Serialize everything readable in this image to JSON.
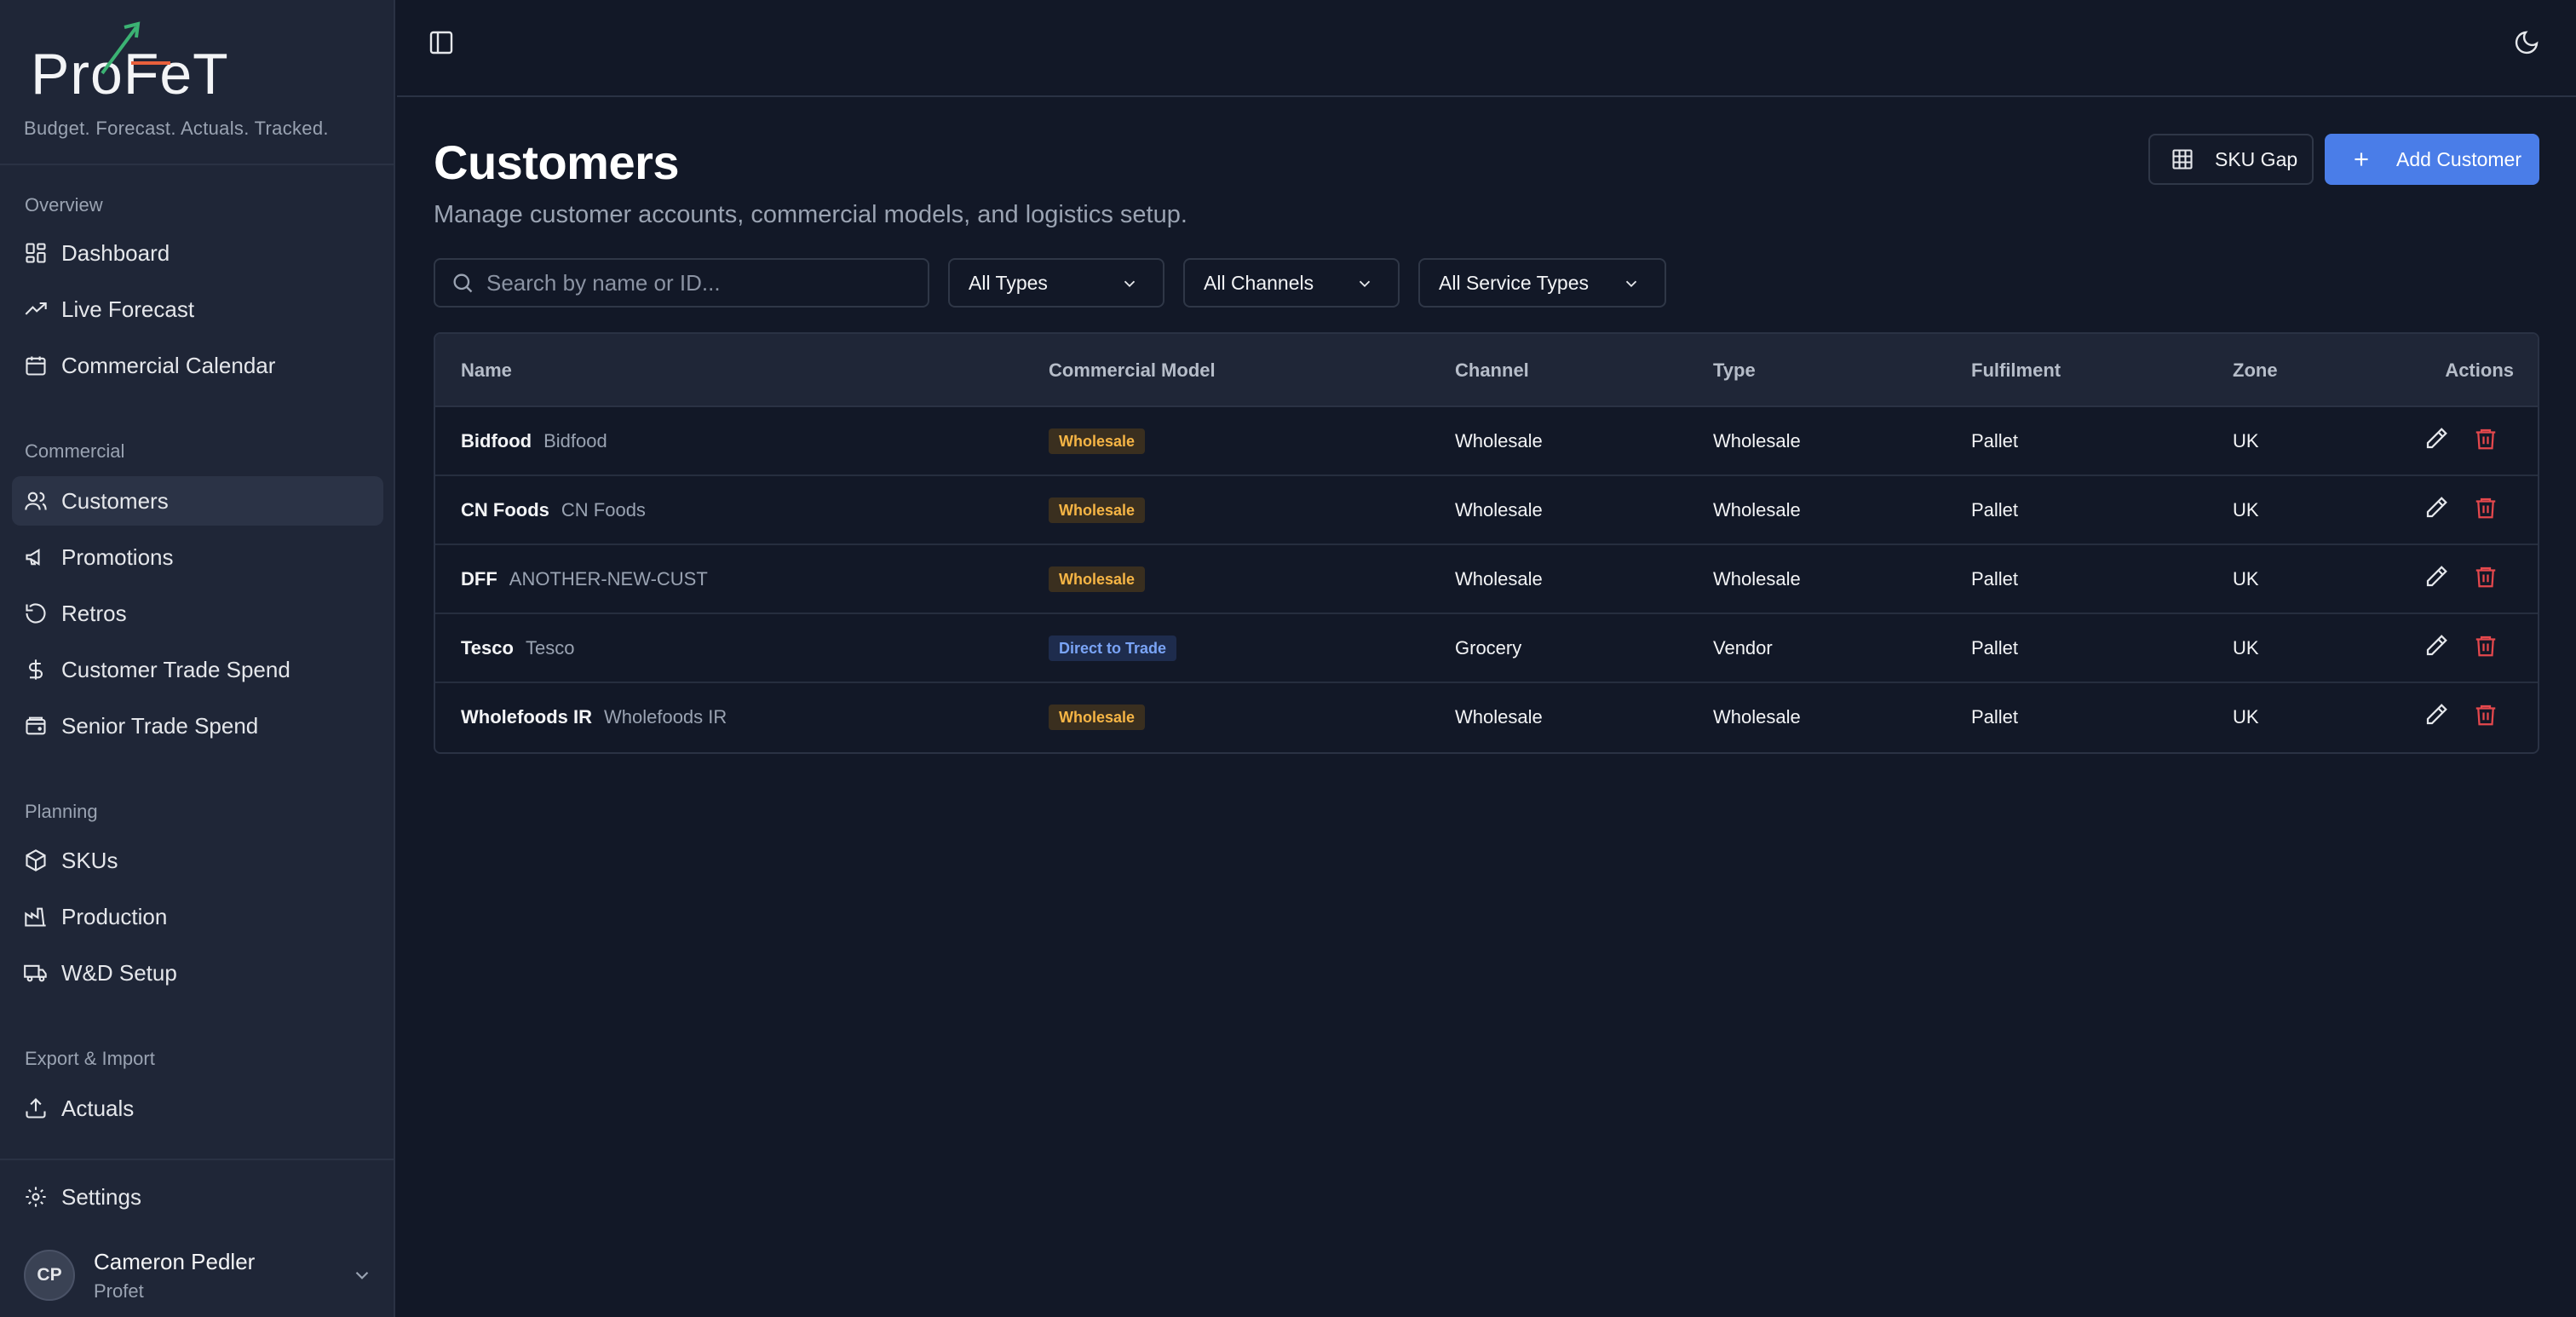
{
  "brand": {
    "logo_text": "ProFeT",
    "tagline": "Budget. Forecast. Actuals. Tracked."
  },
  "sidebar": {
    "sections": [
      {
        "heading": "Overview",
        "items": [
          {
            "label": "Dashboard",
            "icon": "dashboard-icon"
          },
          {
            "label": "Live Forecast",
            "icon": "trending-up-icon"
          },
          {
            "label": "Commercial Calendar",
            "icon": "calendar-icon"
          }
        ]
      },
      {
        "heading": "Commercial",
        "items": [
          {
            "label": "Customers",
            "icon": "users-icon",
            "active": true
          },
          {
            "label": "Promotions",
            "icon": "megaphone-icon"
          },
          {
            "label": "Retros",
            "icon": "rotate-ccw-icon"
          },
          {
            "label": "Customer Trade Spend",
            "icon": "dollar-icon"
          },
          {
            "label": "Senior Trade Spend",
            "icon": "wallet-icon"
          }
        ]
      },
      {
        "heading": "Planning",
        "items": [
          {
            "label": "SKUs",
            "icon": "package-icon"
          },
          {
            "label": "Production",
            "icon": "factory-icon"
          },
          {
            "label": "W&D Setup",
            "icon": "truck-icon"
          }
        ]
      },
      {
        "heading": "Export & Import",
        "items": [
          {
            "label": "Actuals",
            "icon": "upload-icon"
          }
        ]
      }
    ],
    "settings_label": "Settings",
    "user": {
      "initials": "CP",
      "name": "Cameron Pedler",
      "org": "Profet"
    }
  },
  "page": {
    "title": "Customers",
    "subtitle": "Manage customer accounts, commercial models, and logistics setup.",
    "sku_gap_label": "SKU Gap",
    "add_customer_label": "Add Customer"
  },
  "filters": {
    "search_placeholder": "Search by name or ID...",
    "types": "All Types",
    "channels": "All Channels",
    "service_types": "All Service Types"
  },
  "table": {
    "headers": {
      "name": "Name",
      "commercial_model": "Commercial Model",
      "channel": "Channel",
      "type": "Type",
      "fulfilment": "Fulfilment",
      "zone": "Zone",
      "actions": "Actions"
    },
    "rows": [
      {
        "name": "Bidfood",
        "id": "Bidfood",
        "model": "Wholesale",
        "model_style": "wholesale",
        "channel": "Wholesale",
        "type": "Wholesale",
        "fulfilment": "Pallet",
        "zone": "UK"
      },
      {
        "name": "CN Foods",
        "id": "CN Foods",
        "model": "Wholesale",
        "model_style": "wholesale",
        "channel": "Wholesale",
        "type": "Wholesale",
        "fulfilment": "Pallet",
        "zone": "UK"
      },
      {
        "name": "DFF",
        "id": "ANOTHER-NEW-CUST",
        "model": "Wholesale",
        "model_style": "wholesale",
        "channel": "Wholesale",
        "type": "Wholesale",
        "fulfilment": "Pallet",
        "zone": "UK"
      },
      {
        "name": "Tesco",
        "id": "Tesco",
        "model": "Direct to Trade",
        "model_style": "dtt",
        "channel": "Grocery",
        "type": "Vendor",
        "fulfilment": "Pallet",
        "zone": "UK"
      },
      {
        "name": "Wholefoods IR",
        "id": "Wholefoods IR",
        "model": "Wholesale",
        "model_style": "wholesale",
        "channel": "Wholesale",
        "type": "Wholesale",
        "fulfilment": "Pallet",
        "zone": "UK"
      }
    ]
  },
  "colors": {
    "background": "#121827",
    "sidebar": "#1f2637",
    "accent": "#4a7de8",
    "wholesale_badge": "#f6b545",
    "dtt_badge": "#7aa4f6",
    "delete": "#e5484d"
  }
}
